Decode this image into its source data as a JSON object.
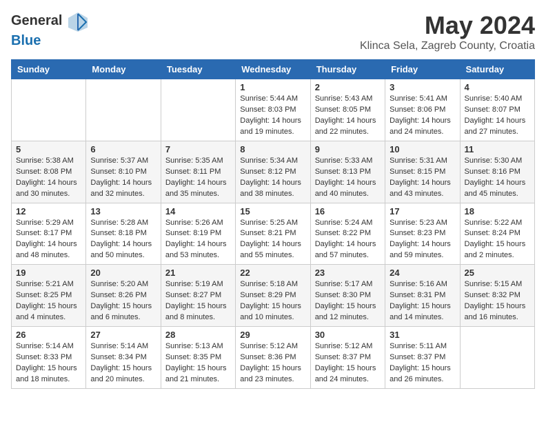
{
  "header": {
    "logo_general": "General",
    "logo_blue": "Blue",
    "month": "May 2024",
    "location": "Klinca Sela, Zagreb County, Croatia"
  },
  "days_of_week": [
    "Sunday",
    "Monday",
    "Tuesday",
    "Wednesday",
    "Thursday",
    "Friday",
    "Saturday"
  ],
  "weeks": [
    [
      {
        "day": "",
        "content": ""
      },
      {
        "day": "",
        "content": ""
      },
      {
        "day": "",
        "content": ""
      },
      {
        "day": "1",
        "content": "Sunrise: 5:44 AM\nSunset: 8:03 PM\nDaylight: 14 hours\nand 19 minutes."
      },
      {
        "day": "2",
        "content": "Sunrise: 5:43 AM\nSunset: 8:05 PM\nDaylight: 14 hours\nand 22 minutes."
      },
      {
        "day": "3",
        "content": "Sunrise: 5:41 AM\nSunset: 8:06 PM\nDaylight: 14 hours\nand 24 minutes."
      },
      {
        "day": "4",
        "content": "Sunrise: 5:40 AM\nSunset: 8:07 PM\nDaylight: 14 hours\nand 27 minutes."
      }
    ],
    [
      {
        "day": "5",
        "content": "Sunrise: 5:38 AM\nSunset: 8:08 PM\nDaylight: 14 hours\nand 30 minutes."
      },
      {
        "day": "6",
        "content": "Sunrise: 5:37 AM\nSunset: 8:10 PM\nDaylight: 14 hours\nand 32 minutes."
      },
      {
        "day": "7",
        "content": "Sunrise: 5:35 AM\nSunset: 8:11 PM\nDaylight: 14 hours\nand 35 minutes."
      },
      {
        "day": "8",
        "content": "Sunrise: 5:34 AM\nSunset: 8:12 PM\nDaylight: 14 hours\nand 38 minutes."
      },
      {
        "day": "9",
        "content": "Sunrise: 5:33 AM\nSunset: 8:13 PM\nDaylight: 14 hours\nand 40 minutes."
      },
      {
        "day": "10",
        "content": "Sunrise: 5:31 AM\nSunset: 8:15 PM\nDaylight: 14 hours\nand 43 minutes."
      },
      {
        "day": "11",
        "content": "Sunrise: 5:30 AM\nSunset: 8:16 PM\nDaylight: 14 hours\nand 45 minutes."
      }
    ],
    [
      {
        "day": "12",
        "content": "Sunrise: 5:29 AM\nSunset: 8:17 PM\nDaylight: 14 hours\nand 48 minutes."
      },
      {
        "day": "13",
        "content": "Sunrise: 5:28 AM\nSunset: 8:18 PM\nDaylight: 14 hours\nand 50 minutes."
      },
      {
        "day": "14",
        "content": "Sunrise: 5:26 AM\nSunset: 8:19 PM\nDaylight: 14 hours\nand 53 minutes."
      },
      {
        "day": "15",
        "content": "Sunrise: 5:25 AM\nSunset: 8:21 PM\nDaylight: 14 hours\nand 55 minutes."
      },
      {
        "day": "16",
        "content": "Sunrise: 5:24 AM\nSunset: 8:22 PM\nDaylight: 14 hours\nand 57 minutes."
      },
      {
        "day": "17",
        "content": "Sunrise: 5:23 AM\nSunset: 8:23 PM\nDaylight: 14 hours\nand 59 minutes."
      },
      {
        "day": "18",
        "content": "Sunrise: 5:22 AM\nSunset: 8:24 PM\nDaylight: 15 hours\nand 2 minutes."
      }
    ],
    [
      {
        "day": "19",
        "content": "Sunrise: 5:21 AM\nSunset: 8:25 PM\nDaylight: 15 hours\nand 4 minutes."
      },
      {
        "day": "20",
        "content": "Sunrise: 5:20 AM\nSunset: 8:26 PM\nDaylight: 15 hours\nand 6 minutes."
      },
      {
        "day": "21",
        "content": "Sunrise: 5:19 AM\nSunset: 8:27 PM\nDaylight: 15 hours\nand 8 minutes."
      },
      {
        "day": "22",
        "content": "Sunrise: 5:18 AM\nSunset: 8:29 PM\nDaylight: 15 hours\nand 10 minutes."
      },
      {
        "day": "23",
        "content": "Sunrise: 5:17 AM\nSunset: 8:30 PM\nDaylight: 15 hours\nand 12 minutes."
      },
      {
        "day": "24",
        "content": "Sunrise: 5:16 AM\nSunset: 8:31 PM\nDaylight: 15 hours\nand 14 minutes."
      },
      {
        "day": "25",
        "content": "Sunrise: 5:15 AM\nSunset: 8:32 PM\nDaylight: 15 hours\nand 16 minutes."
      }
    ],
    [
      {
        "day": "26",
        "content": "Sunrise: 5:14 AM\nSunset: 8:33 PM\nDaylight: 15 hours\nand 18 minutes."
      },
      {
        "day": "27",
        "content": "Sunrise: 5:14 AM\nSunset: 8:34 PM\nDaylight: 15 hours\nand 20 minutes."
      },
      {
        "day": "28",
        "content": "Sunrise: 5:13 AM\nSunset: 8:35 PM\nDaylight: 15 hours\nand 21 minutes."
      },
      {
        "day": "29",
        "content": "Sunrise: 5:12 AM\nSunset: 8:36 PM\nDaylight: 15 hours\nand 23 minutes."
      },
      {
        "day": "30",
        "content": "Sunrise: 5:12 AM\nSunset: 8:37 PM\nDaylight: 15 hours\nand 24 minutes."
      },
      {
        "day": "31",
        "content": "Sunrise: 5:11 AM\nSunset: 8:37 PM\nDaylight: 15 hours\nand 26 minutes."
      },
      {
        "day": "",
        "content": ""
      }
    ]
  ]
}
